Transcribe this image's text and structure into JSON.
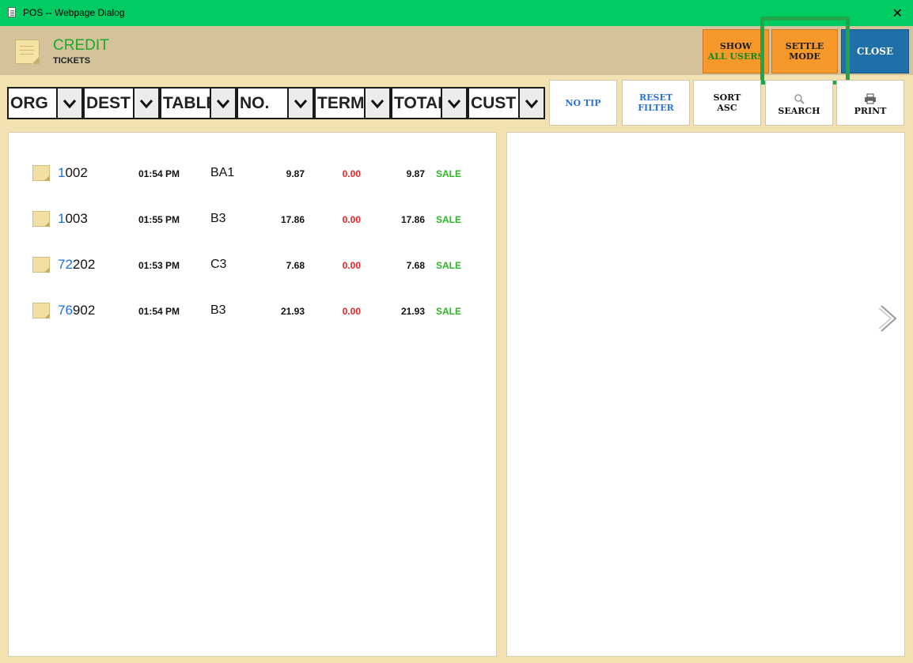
{
  "window": {
    "title": "POS -- Webpage Dialog",
    "close_glyph": "✕"
  },
  "header": {
    "title": "CREDIT",
    "subtitle": "TICKETS",
    "buttons": {
      "show": {
        "line1": "SHOW",
        "line2": "ALL USERS"
      },
      "settle": {
        "line1": "SETTLE",
        "line2": "MODE"
      },
      "close": {
        "label": "CLOSE"
      }
    }
  },
  "filters": [
    {
      "label": "ORG"
    },
    {
      "label": "DEST"
    },
    {
      "label": "TABLE"
    },
    {
      "label": "NO."
    },
    {
      "label": "TERM"
    },
    {
      "label": "TOTAL"
    },
    {
      "label": "CUST"
    }
  ],
  "toolbar": {
    "no_tip": "NO TIP",
    "reset": {
      "line1": "RESET",
      "line2": "FILTER"
    },
    "sort": {
      "line1": "SORT",
      "line2": "ASC"
    },
    "search": "SEARCH",
    "print": "PRINT"
  },
  "tickets": [
    {
      "num_prefix": "1",
      "num_rest": "002",
      "time": "01:54 PM",
      "table": "BA1",
      "subtotal": "9.87",
      "tip": "0.00",
      "total": "9.87",
      "type": "SALE"
    },
    {
      "num_prefix": "1",
      "num_rest": "003",
      "time": "01:55 PM",
      "table": "B3",
      "subtotal": "17.86",
      "tip": "0.00",
      "total": "17.86",
      "type": "SALE"
    },
    {
      "num_prefix": "72",
      "num_rest": "202",
      "time": "01:53 PM",
      "table": "C3",
      "subtotal": "7.68",
      "tip": "0.00",
      "total": "7.68",
      "type": "SALE"
    },
    {
      "num_prefix": "76",
      "num_rest": "902",
      "time": "01:54 PM",
      "table": "B3",
      "subtotal": "21.93",
      "tip": "0.00",
      "total": "21.93",
      "type": "SALE"
    }
  ],
  "colors": {
    "titlebar": "#00cc63",
    "header": "#d3c29a",
    "accent_orange": "#f7982a",
    "close_blue": "#1f6fa8",
    "highlight": "#22a448",
    "sale_green": "#2fb52a",
    "tip_red": "#e3262a"
  },
  "icons": {
    "window": "document-icon",
    "header": "ticket-icon",
    "search": "magnifier-icon",
    "print": "printer-icon",
    "next": "chevron-right-icon"
  }
}
